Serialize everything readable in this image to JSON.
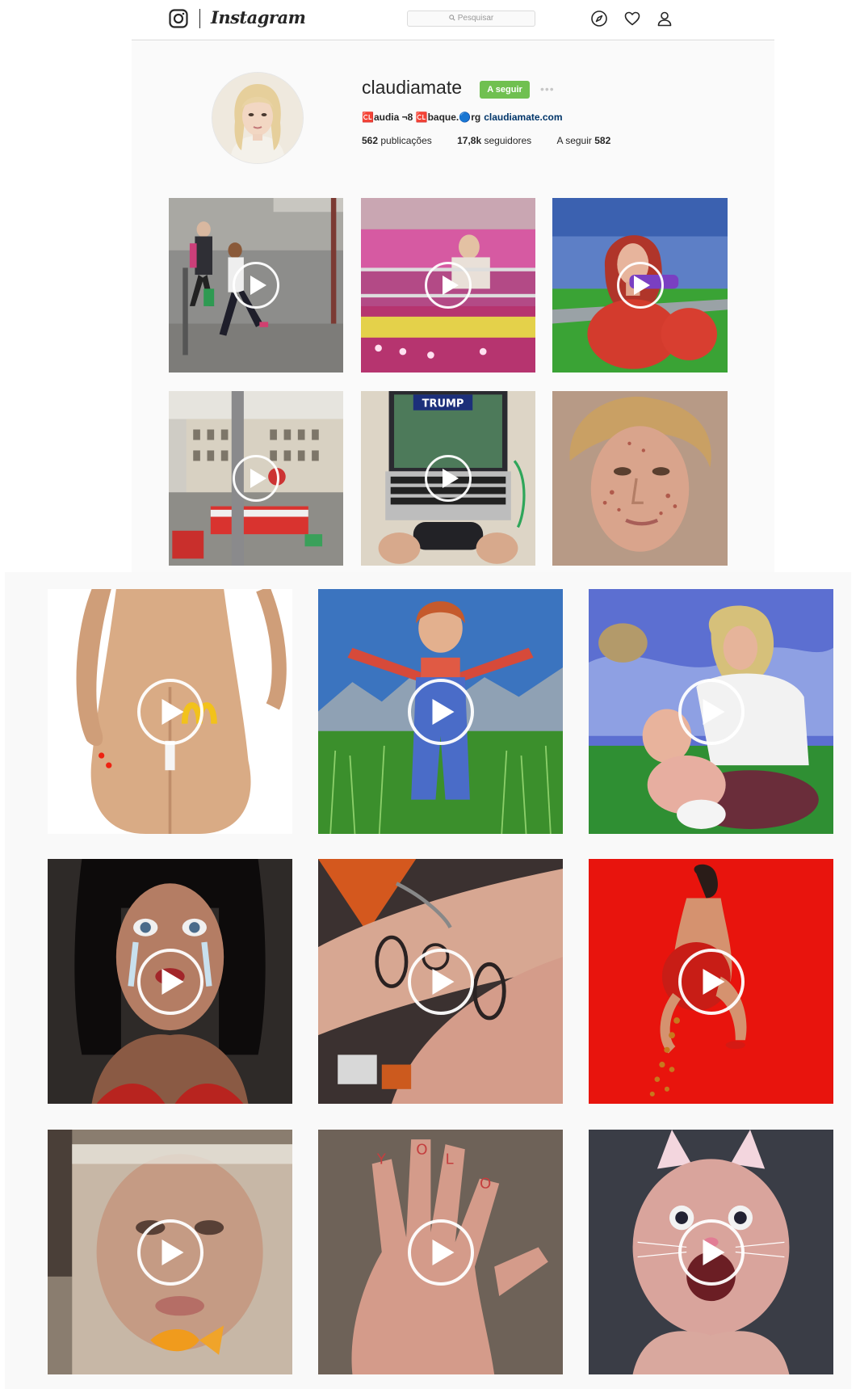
{
  "navbar": {
    "logo_text": "Instagram",
    "search_placeholder": "Pesquisar",
    "icons": [
      "instagram-camera-icon",
      "search-icon",
      "explore-compass-icon",
      "heart-icon",
      "profile-person-icon"
    ]
  },
  "profile": {
    "username": "claudiamate",
    "follow_label": "A seguir",
    "more_label": "•••",
    "bio_text": "🆑audia ¬8 🆑baque.🔵rg",
    "bio_link": "claudiamate.com",
    "stats": {
      "posts_count": "562",
      "posts_label": "publicações",
      "followers_count": "17,8k",
      "followers_label": "seguidores",
      "following_label": "A seguir",
      "following_count": "582"
    }
  },
  "colors": {
    "follow_green": "#70c050",
    "link_blue": "#003569",
    "border": "#dbdbdb",
    "background": "#fafafa"
  },
  "posts": [
    {
      "id": "running-woman-street",
      "video": true
    },
    {
      "id": "pink-carousel-ride",
      "video": true
    },
    {
      "id": "redhead-3d-avatar-car",
      "video": true
    },
    {
      "id": "city-tram-street",
      "video": true
    },
    {
      "id": "laptop-trump-game",
      "video": true
    },
    {
      "id": "acne-face-portrait",
      "video": false
    },
    {
      "id": "3d-body-back-logo",
      "video": true
    },
    {
      "id": "3d-doll-in-field",
      "video": true
    },
    {
      "id": "3d-woman-with-baby",
      "video": true
    },
    {
      "id": "3d-crying-woman",
      "video": true
    },
    {
      "id": "scream-mask-tattoos",
      "video": true
    },
    {
      "id": "3d-figure-red-background",
      "video": true
    },
    {
      "id": "face-in-water-bag-goldfish",
      "video": true
    },
    {
      "id": "hand-with-writing",
      "video": true
    },
    {
      "id": "baby-bunny-filter",
      "video": true
    }
  ]
}
